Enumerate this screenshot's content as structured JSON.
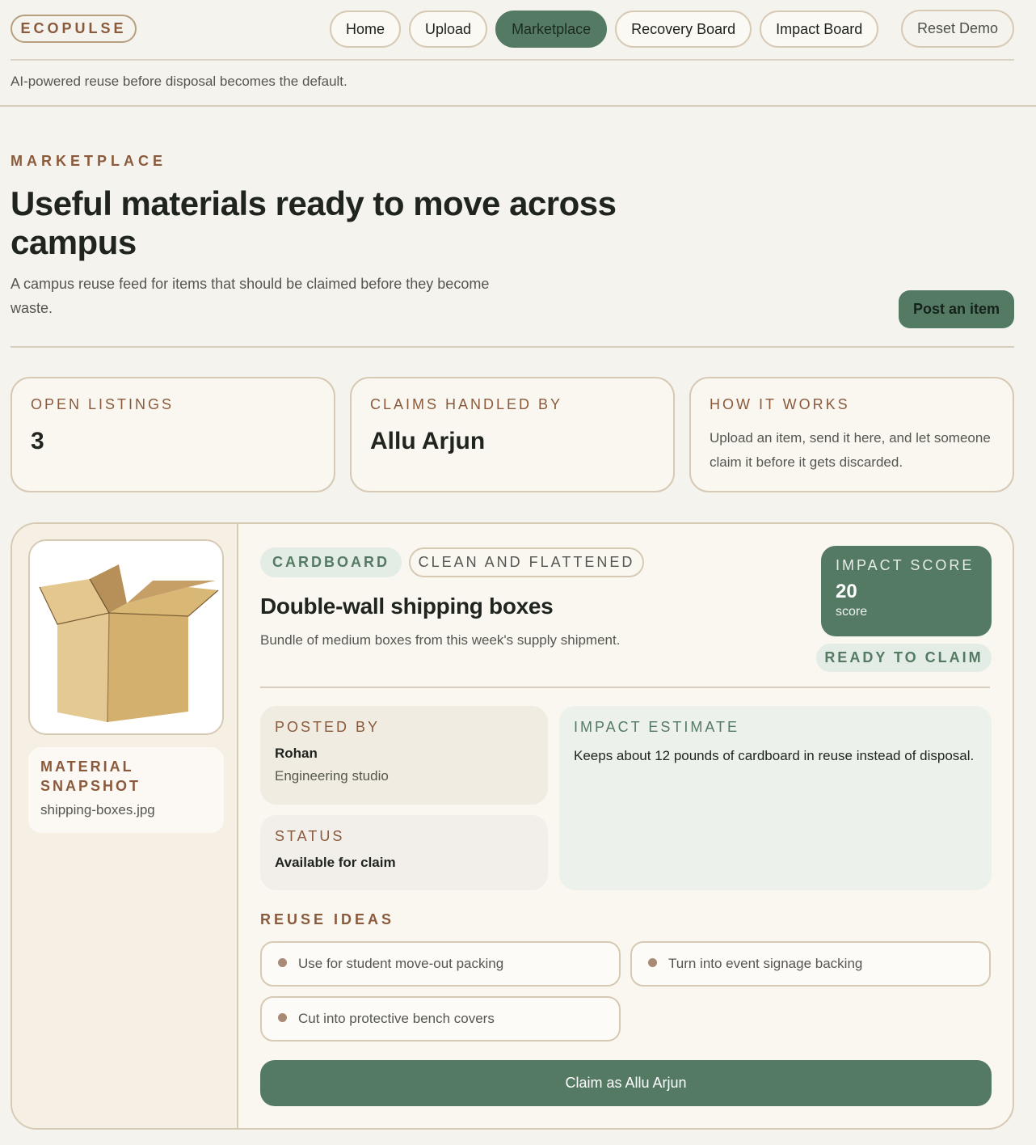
{
  "brand": "ECOPULSE",
  "nav": {
    "items": [
      {
        "label": "Home"
      },
      {
        "label": "Upload"
      },
      {
        "label": "Marketplace",
        "active": true
      },
      {
        "label": "Recovery Board"
      },
      {
        "label": "Impact Board"
      }
    ],
    "reset_label": "Reset Demo"
  },
  "tagline": "AI-powered reuse before disposal becomes the default.",
  "hero": {
    "eyebrow": "MARKETPLACE",
    "title": "Useful materials ready to move across campus",
    "subtitle": "A campus reuse feed for items that should be claimed before they become waste.",
    "post_button": "Post an item"
  },
  "stats": {
    "open_listings": {
      "label": "OPEN LISTINGS",
      "value": "3"
    },
    "claims": {
      "label": "CLAIMS HANDLED BY",
      "value": "Allu Arjun"
    },
    "how": {
      "label": "HOW IT WORKS",
      "text": "Upload an item, send it here, and let someone claim it before it gets discarded."
    }
  },
  "listing": {
    "image_icon": "cardboard-box-photo",
    "snapshot_label": "MATERIAL SNAPSHOT",
    "filename": "shipping-boxes.jpg",
    "material": "CARDBOARD",
    "condition": "CLEAN AND FLATTENED",
    "title": "Double-wall shipping boxes",
    "description": "Bundle of medium boxes from this week's supply shipment.",
    "score_label": "IMPACT SCORE",
    "score": "20",
    "score_unit": "score",
    "status_chip": "READY TO CLAIM",
    "posted_label": "POSTED BY",
    "posted_name": "Rohan",
    "posted_org": "Engineering studio",
    "status_label": "STATUS",
    "status_value": "Available for claim",
    "impact_label": "IMPACT ESTIMATE",
    "impact_text": "Keeps about 12 pounds of cardboard in reuse instead of disposal.",
    "ideas_label": "REUSE IDEAS",
    "ideas": [
      "Use for student move-out packing",
      "Turn into event signage backing",
      "Cut into protective bench covers"
    ],
    "claim_button": "Claim as Allu Arjun"
  },
  "colors": {
    "accent": "#557a64",
    "brown": "#8a5a3c",
    "background": "#f5f3ee"
  }
}
